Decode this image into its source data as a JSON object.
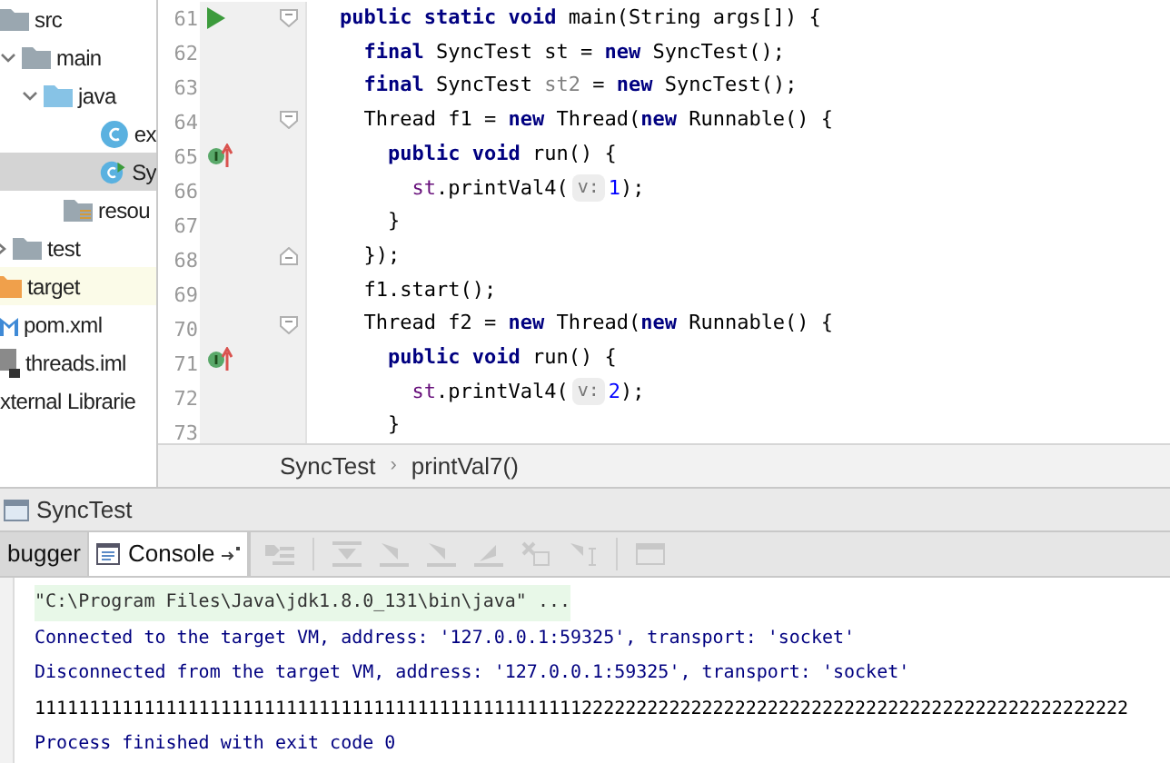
{
  "project_tree": [
    {
      "label": "src",
      "kind": "folder",
      "children": [
        {
          "label": "main",
          "kind": "folder",
          "expanded": true,
          "children": [
            {
              "label": "java",
              "kind": "source",
              "expanded": true,
              "children": [
                {
                  "label": "ex",
                  "kind": "class",
                  "selected": false
                },
                {
                  "label": "Sy",
                  "kind": "mainclass",
                  "selected": true
                }
              ]
            },
            {
              "label": "resou",
              "kind": "resources",
              "selected": false
            }
          ]
        },
        {
          "label": "test",
          "kind": "folder",
          "expanded": false
        }
      ]
    },
    {
      "label": "target",
      "kind": "excluded",
      "selected": false,
      "highlighted": true
    },
    {
      "label": "pom.xml",
      "kind": "maven",
      "selected": false
    },
    {
      "label": "threads.iml",
      "kind": "module",
      "selected": false
    },
    {
      "label": "xternal Librarie",
      "kind": "text",
      "selected": false
    }
  ],
  "editor": {
    "lines": [
      {
        "number": "61",
        "run_marker": true,
        "implements_marker": false,
        "fold_start": true,
        "fold_end": false,
        "tokens": [
          {
            "kind": "kw",
            "text": "public static void "
          },
          {
            "kind": "plain",
            "text": "main(String args[]) {"
          }
        ]
      },
      {
        "number": "62",
        "run_marker": false,
        "implements_marker": false,
        "fold_start": false,
        "fold_end": false,
        "tokens": [
          {
            "kind": "kw",
            "text": "  final "
          },
          {
            "kind": "plain",
            "text": "SyncTest st = "
          },
          {
            "kind": "kw",
            "text": "new "
          },
          {
            "kind": "plain",
            "text": "SyncTest();"
          }
        ]
      },
      {
        "number": "63",
        "run_marker": false,
        "implements_marker": false,
        "fold_start": false,
        "fold_end": false,
        "tokens": [
          {
            "kind": "kw",
            "text": "  final "
          },
          {
            "kind": "plain",
            "text": "SyncTest "
          },
          {
            "kind": "unused",
            "text": "st2"
          },
          {
            "kind": "plain",
            "text": " = "
          },
          {
            "kind": "kw",
            "text": "new "
          },
          {
            "kind": "plain",
            "text": "SyncTest();"
          }
        ]
      },
      {
        "number": "64",
        "run_marker": false,
        "implements_marker": false,
        "fold_start": true,
        "fold_end": false,
        "tokens": [
          {
            "kind": "plain",
            "text": "  Thread f1 = "
          },
          {
            "kind": "kw",
            "text": "new "
          },
          {
            "kind": "plain",
            "text": "Thread("
          },
          {
            "kind": "kw",
            "text": "new "
          },
          {
            "kind": "plain",
            "text": "Runnable() {"
          }
        ]
      },
      {
        "number": "65",
        "run_marker": false,
        "implements_marker": true,
        "fold_start": false,
        "fold_end": false,
        "tokens": [
          {
            "kind": "kw",
            "text": "    public void "
          },
          {
            "kind": "plain",
            "text": "run() {"
          }
        ]
      },
      {
        "number": "66",
        "run_marker": false,
        "implements_marker": false,
        "fold_start": false,
        "fold_end": false,
        "tokens": [
          {
            "kind": "field",
            "text": "      st"
          },
          {
            "kind": "plain",
            "text": ".printVal4("
          },
          {
            "kind": "hint",
            "text": "v:"
          },
          {
            "kind": "num",
            "text": "1"
          },
          {
            "kind": "plain",
            "text": ");"
          }
        ]
      },
      {
        "number": "67",
        "run_marker": false,
        "implements_marker": false,
        "fold_start": false,
        "fold_end": false,
        "tokens": [
          {
            "kind": "plain",
            "text": "    }"
          }
        ]
      },
      {
        "number": "68",
        "run_marker": false,
        "implements_marker": false,
        "fold_start": false,
        "fold_end": true,
        "tokens": [
          {
            "kind": "plain",
            "text": "  });"
          }
        ]
      },
      {
        "number": "69",
        "run_marker": false,
        "implements_marker": false,
        "fold_start": false,
        "fold_end": false,
        "tokens": [
          {
            "kind": "plain",
            "text": "  f1.start();"
          }
        ]
      },
      {
        "number": "70",
        "run_marker": false,
        "implements_marker": false,
        "fold_start": true,
        "fold_end": false,
        "tokens": [
          {
            "kind": "plain",
            "text": "  Thread f2 = "
          },
          {
            "kind": "kw",
            "text": "new "
          },
          {
            "kind": "plain",
            "text": "Thread("
          },
          {
            "kind": "kw",
            "text": "new "
          },
          {
            "kind": "plain",
            "text": "Runnable() {"
          }
        ]
      },
      {
        "number": "71",
        "run_marker": false,
        "implements_marker": true,
        "fold_start": false,
        "fold_end": false,
        "tokens": [
          {
            "kind": "kw",
            "text": "    public void "
          },
          {
            "kind": "plain",
            "text": "run() {"
          }
        ]
      },
      {
        "number": "72",
        "run_marker": false,
        "implements_marker": false,
        "fold_start": false,
        "fold_end": false,
        "tokens": [
          {
            "kind": "field",
            "text": "      st"
          },
          {
            "kind": "plain",
            "text": ".printVal4("
          },
          {
            "kind": "hint",
            "text": "v:"
          },
          {
            "kind": "num",
            "text": "2"
          },
          {
            "kind": "plain",
            "text": ");"
          }
        ]
      },
      {
        "number": "73",
        "run_marker": false,
        "implements_marker": false,
        "fold_start": false,
        "fold_end": false,
        "tokens": [
          {
            "kind": "plain",
            "text": "    }"
          }
        ]
      }
    ]
  },
  "breadcrumbs": [
    "SyncTest",
    "›",
    "printVal7()"
  ],
  "run_window": {
    "title": "SyncTest",
    "tabs": [
      {
        "label": "bugger",
        "selected": false
      },
      {
        "label": "Console",
        "selected": true
      }
    ],
    "console": [
      {
        "kind": "command",
        "text": "\"C:\\Program Files\\Java\\jdk1.8.0_131\\bin\\java\" ..."
      },
      {
        "kind": "system",
        "text": "Connected to the target VM, address: '127.0.0.1:59325', transport: 'socket'"
      },
      {
        "kind": "system",
        "text": "Disconnected from the target VM, address: '127.0.0.1:59325', transport: 'socket'"
      },
      {
        "kind": "output",
        "text": "1111111111111111111111111111111111111111111111111122222222222222222222222222222222222222222222222222"
      },
      {
        "kind": "system",
        "text": "Process finished with exit code 0"
      }
    ]
  }
}
